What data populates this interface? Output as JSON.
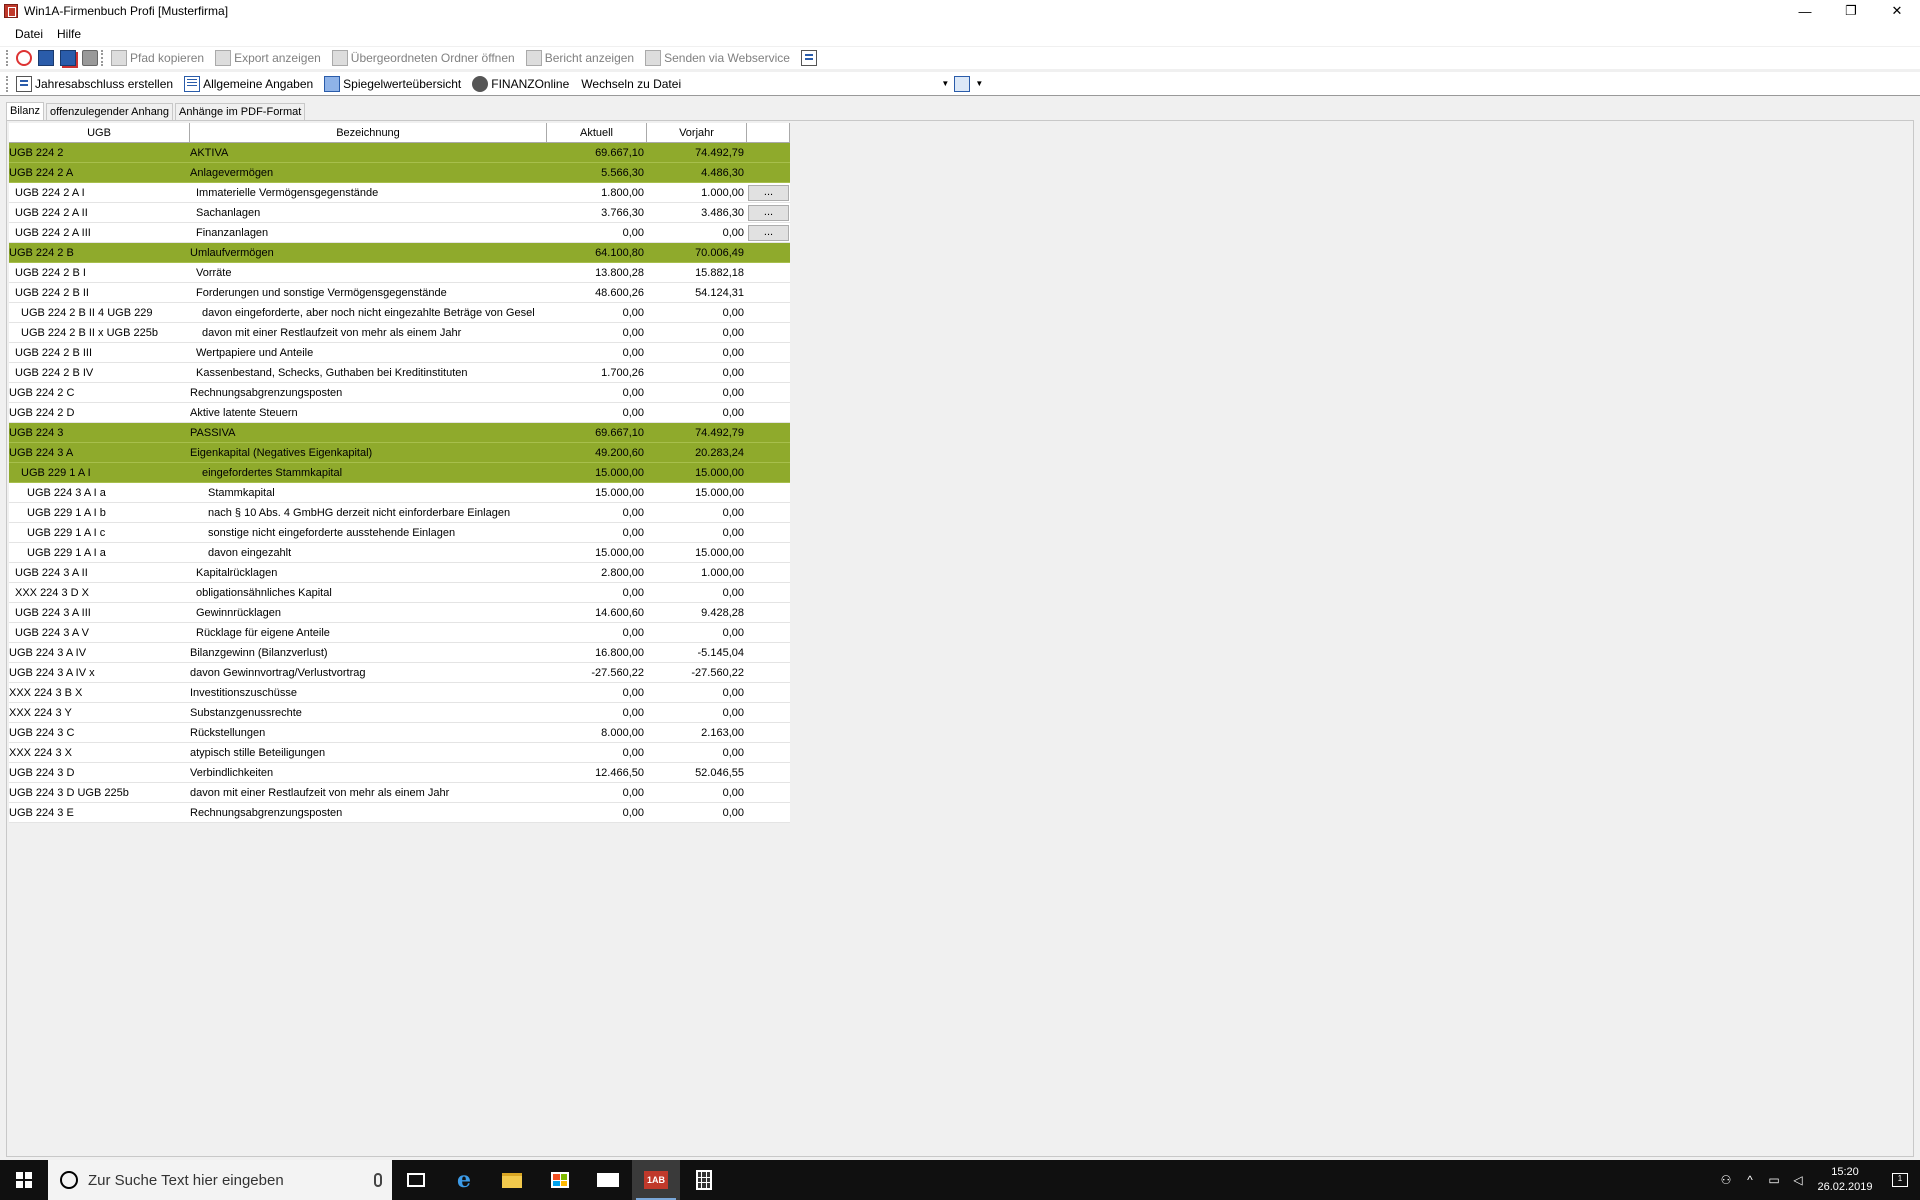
{
  "window": {
    "title": "Win1A-Firmenbuch Profi [Musterfirma]",
    "controls": {
      "minimize": "—",
      "maximize": "❐",
      "close": "✕"
    }
  },
  "menu": {
    "items": [
      "Datei",
      "Hilfe"
    ]
  },
  "toolbar1": {
    "buttons": [
      {
        "label": "Pfad kopieren",
        "icon": "copy-path-icon",
        "enabled": false
      },
      {
        "label": "Export anzeigen",
        "icon": "export-icon",
        "enabled": false
      },
      {
        "label": "Übergeordneten Ordner öffnen",
        "icon": "folder-up-icon",
        "enabled": false
      },
      {
        "label": "Bericht anzeigen",
        "icon": "report-icon",
        "enabled": false
      },
      {
        "label": "Senden via Webservice",
        "icon": "webservice-icon",
        "enabled": false
      }
    ]
  },
  "toolbar2": {
    "buttons": [
      {
        "label": "Jahresabschluss erstellen",
        "icon": "annual-report-icon"
      },
      {
        "label": "Allgemeine Angaben",
        "icon": "general-info-icon"
      },
      {
        "label": "Spiegelwerteübersicht",
        "icon": "mirror-values-icon"
      },
      {
        "label": "FINANZOnline",
        "icon": "finanzonline-eagle-icon"
      }
    ],
    "file_combo": {
      "value": "Wechseln zu Datei"
    }
  },
  "tabs": [
    {
      "label": "Bilanz",
      "active": true
    },
    {
      "label": "offenzulegender Anhang",
      "active": false
    },
    {
      "label": "Anhänge im PDF-Format",
      "active": false
    }
  ],
  "grid": {
    "columns": [
      "UGB",
      "Bezeichnung",
      "Aktuell",
      "Vorjahr"
    ],
    "highlight_color": "#8faa2c",
    "rows": [
      {
        "ugb": "UGB 224 2",
        "bez": "AKTIVA",
        "akt": "69.667,10",
        "vor": "74.492,79",
        "level": 1,
        "hl": true,
        "btn": false
      },
      {
        "ugb": "UGB 224 2 A",
        "bez": "Anlagevermögen",
        "akt": "5.566,30",
        "vor": "4.486,30",
        "level": 1,
        "hl": true,
        "btn": false
      },
      {
        "ugb": "UGB 224 2 A I",
        "bez": "Immaterielle Vermögensgegenstände",
        "akt": "1.800,00",
        "vor": "1.000,00",
        "level": 2,
        "hl": false,
        "btn": true
      },
      {
        "ugb": "UGB 224 2 A II",
        "bez": "Sachanlagen",
        "akt": "3.766,30",
        "vor": "3.486,30",
        "level": 2,
        "hl": false,
        "btn": true
      },
      {
        "ugb": "UGB 224 2 A III",
        "bez": "Finanzanlagen",
        "akt": "0,00",
        "vor": "0,00",
        "level": 2,
        "hl": false,
        "btn": true
      },
      {
        "ugb": "UGB 224 2 B",
        "bez": "Umlaufvermögen",
        "akt": "64.100,80",
        "vor": "70.006,49",
        "level": 1,
        "hl": true,
        "btn": false
      },
      {
        "ugb": "UGB 224 2 B I",
        "bez": "Vorräte",
        "akt": "13.800,28",
        "vor": "15.882,18",
        "level": 2,
        "hl": false,
        "btn": false
      },
      {
        "ugb": "UGB 224 2 B II",
        "bez": "Forderungen und sonstige Vermögensgegenstände",
        "akt": "48.600,26",
        "vor": "54.124,31",
        "level": 2,
        "hl": false,
        "btn": false
      },
      {
        "ugb": "UGB 224 2 B II 4 UGB 229",
        "bez": "davon eingeforderte, aber noch nicht eingezahlte Beträge von Gesel",
        "akt": "0,00",
        "vor": "0,00",
        "level": 3,
        "hl": false,
        "btn": false
      },
      {
        "ugb": "UGB 224 2 B II x UGB 225b",
        "bez": "davon mit einer Restlaufzeit von mehr als einem Jahr",
        "akt": "0,00",
        "vor": "0,00",
        "level": 3,
        "hl": false,
        "btn": false
      },
      {
        "ugb": "UGB 224 2 B III",
        "bez": "Wertpapiere und Anteile",
        "akt": "0,00",
        "vor": "0,00",
        "level": 2,
        "hl": false,
        "btn": false
      },
      {
        "ugb": "UGB 224 2 B IV",
        "bez": "Kassenbestand, Schecks, Guthaben bei Kreditinstituten",
        "akt": "1.700,26",
        "vor": "0,00",
        "level": 2,
        "hl": false,
        "btn": false
      },
      {
        "ugb": "UGB 224 2 C",
        "bez": "Rechnungsabgrenzungsposten",
        "akt": "0,00",
        "vor": "0,00",
        "level": 1,
        "hl": false,
        "btn": false
      },
      {
        "ugb": "UGB 224 2 D",
        "bez": "Aktive latente Steuern",
        "akt": "0,00",
        "vor": "0,00",
        "level": 1,
        "hl": false,
        "btn": false
      },
      {
        "ugb": "UGB 224 3",
        "bez": "PASSIVA",
        "akt": "69.667,10",
        "vor": "74.492,79",
        "level": 1,
        "hl": true,
        "btn": false
      },
      {
        "ugb": "UGB 224 3 A",
        "bez": "Eigenkapital (Negatives Eigenkapital)",
        "akt": "49.200,60",
        "vor": "20.283,24",
        "level": 1,
        "hl": true,
        "btn": false
      },
      {
        "ugb": "UGB 229 1 A I",
        "bez": "eingefordertes Stammkapital",
        "akt": "15.000,00",
        "vor": "15.000,00",
        "level": 3,
        "hl": true,
        "btn": false
      },
      {
        "ugb": "UGB 224 3 A I a",
        "bez": "Stammkapital",
        "akt": "15.000,00",
        "vor": "15.000,00",
        "level": 4,
        "hl": false,
        "btn": false
      },
      {
        "ugb": "UGB 229 1 A I b",
        "bez": "nach § 10 Abs. 4 GmbHG derzeit nicht einforderbare Einlagen",
        "akt": "0,00",
        "vor": "0,00",
        "level": 4,
        "hl": false,
        "btn": false
      },
      {
        "ugb": "UGB 229 1 A I c",
        "bez": "sonstige nicht eingeforderte ausstehende Einlagen",
        "akt": "0,00",
        "vor": "0,00",
        "level": 4,
        "hl": false,
        "btn": false
      },
      {
        "ugb": "UGB 229 1 A I a",
        "bez": "davon eingezahlt",
        "akt": "15.000,00",
        "vor": "15.000,00",
        "level": 4,
        "hl": false,
        "btn": false
      },
      {
        "ugb": "UGB 224 3 A II",
        "bez": "Kapitalrücklagen",
        "akt": "2.800,00",
        "vor": "1.000,00",
        "level": 2,
        "hl": false,
        "btn": false
      },
      {
        "ugb": "XXX 224 3 D X",
        "bez": "obligationsähnliches Kapital",
        "akt": "0,00",
        "vor": "0,00",
        "level": 2,
        "hl": false,
        "btn": false
      },
      {
        "ugb": "UGB 224 3 A III",
        "bez": "Gewinnrücklagen",
        "akt": "14.600,60",
        "vor": "9.428,28",
        "level": 2,
        "hl": false,
        "btn": false
      },
      {
        "ugb": "UGB 224 3 A V",
        "bez": "Rücklage für eigene Anteile",
        "akt": "0,00",
        "vor": "0,00",
        "level": 2,
        "hl": false,
        "btn": false
      },
      {
        "ugb": "UGB 224 3 A IV",
        "bez": "Bilanzgewinn (Bilanzverlust)",
        "akt": "16.800,00",
        "vor": "-5.145,04",
        "level": 1,
        "hl": false,
        "btn": false
      },
      {
        "ugb": "UGB 224 3 A IV x",
        "bez": "davon Gewinnvortrag/Verlustvortrag",
        "akt": "-27.560,22",
        "vor": "-27.560,22",
        "level": 1,
        "hl": false,
        "btn": false
      },
      {
        "ugb": "XXX 224 3 B X",
        "bez": "Investitionszuschüsse",
        "akt": "0,00",
        "vor": "0,00",
        "level": 1,
        "hl": false,
        "btn": false
      },
      {
        "ugb": "XXX 224 3 Y",
        "bez": "Substanzgenussrechte",
        "akt": "0,00",
        "vor": "0,00",
        "level": 1,
        "hl": false,
        "btn": false
      },
      {
        "ugb": "UGB 224 3 C",
        "bez": "Rückstellungen",
        "akt": "8.000,00",
        "vor": "2.163,00",
        "level": 1,
        "hl": false,
        "btn": false
      },
      {
        "ugb": "XXX 224 3 X",
        "bez": "atypisch stille Beteiligungen",
        "akt": "0,00",
        "vor": "0,00",
        "level": 1,
        "hl": false,
        "btn": false
      },
      {
        "ugb": "UGB 224 3 D",
        "bez": "Verbindlichkeiten",
        "akt": "12.466,50",
        "vor": "52.046,55",
        "level": 1,
        "hl": false,
        "btn": false
      },
      {
        "ugb": "UGB 224 3 D UGB 225b",
        "bez": "davon mit einer Restlaufzeit von mehr als einem Jahr",
        "akt": "0,00",
        "vor": "0,00",
        "level": 1,
        "hl": false,
        "btn": false
      },
      {
        "ugb": "UGB 224 3 E",
        "bez": "Rechnungsabgrenzungsposten",
        "akt": "0,00",
        "vor": "0,00",
        "level": 1,
        "hl": false,
        "btn": false
      }
    ],
    "dots_label": "..."
  },
  "taskbar": {
    "search_placeholder": "Zur Suche Text hier eingeben",
    "win1a_label": "1AB",
    "time": "15:20",
    "date": "26.02.2019",
    "notification_count": "1"
  }
}
